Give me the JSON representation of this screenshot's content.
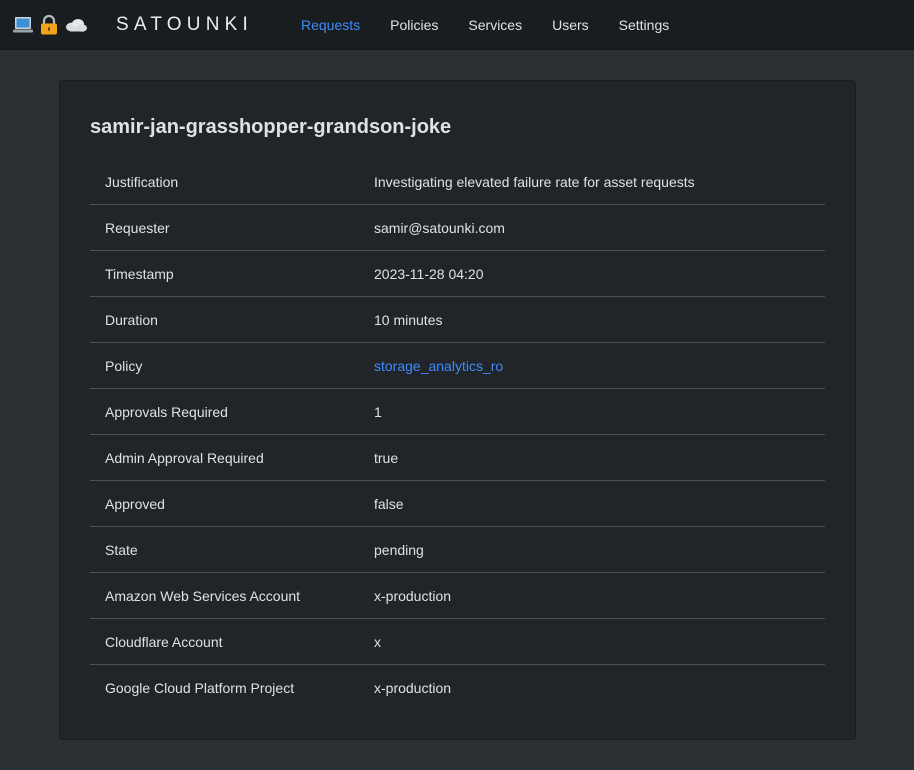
{
  "nav": {
    "brand": "SATOUNKI",
    "icons": [
      "laptop-icon",
      "lock-icon",
      "cloud-icon"
    ],
    "links": [
      {
        "label": "Requests",
        "active": true
      },
      {
        "label": "Policies",
        "active": false
      },
      {
        "label": "Services",
        "active": false
      },
      {
        "label": "Users",
        "active": false
      },
      {
        "label": "Settings",
        "active": false
      }
    ]
  },
  "request": {
    "title": "samir-jan-grasshopper-grandson-joke",
    "rows": [
      {
        "key": "Justification",
        "value": "Investigating elevated failure rate for asset requests"
      },
      {
        "key": "Requester",
        "value": "samir@satounki.com"
      },
      {
        "key": "Timestamp",
        "value": "2023-11-28 04:20"
      },
      {
        "key": "Duration",
        "value": "10 minutes"
      },
      {
        "key": "Policy",
        "value": "storage_analytics_ro"
      },
      {
        "key": "Approvals Required",
        "value": "1"
      },
      {
        "key": "Admin Approval Required",
        "value": "true"
      },
      {
        "key": "Approved",
        "value": "false"
      },
      {
        "key": "State",
        "value": "pending"
      },
      {
        "key": "Amazon Web Services Account",
        "value": "x-production"
      },
      {
        "key": "Cloudflare Account",
        "value": "x"
      },
      {
        "key": "Google Cloud Platform Project",
        "value": "x-production"
      }
    ]
  },
  "colors": {
    "background": "#2b3035",
    "navbar": "#1a1d20",
    "card": "#212529",
    "accent": "#3d8bfd",
    "divider": "#495057"
  }
}
